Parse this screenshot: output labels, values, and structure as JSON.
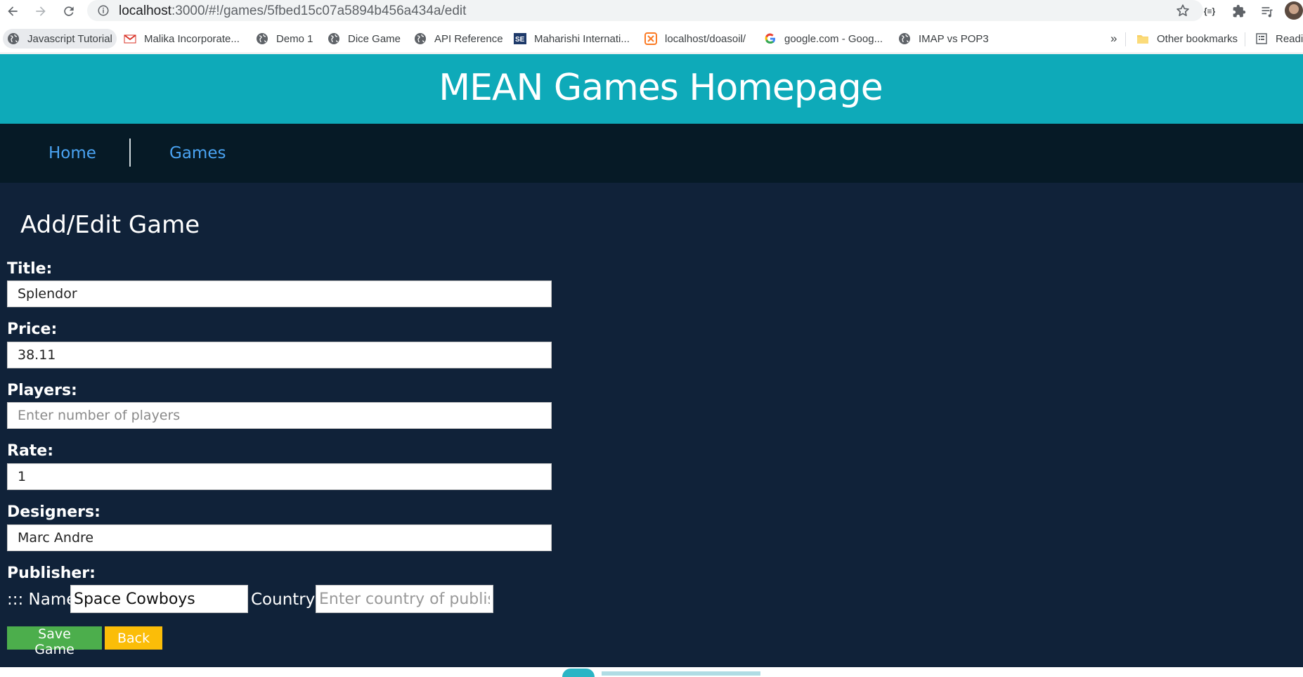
{
  "browser": {
    "url_host": "localhost",
    "url_path": ":3000/#!/games/5fbed15c07a5894b456a434a/edit",
    "bookmarks": [
      {
        "label": "Javascript Tutorial",
        "icon": "globe-icon"
      },
      {
        "label": "Malika Incorporate...",
        "icon": "gmail-icon"
      },
      {
        "label": "Demo 1",
        "icon": "globe-icon"
      },
      {
        "label": "Dice Game",
        "icon": "globe-icon"
      },
      {
        "label": "API Reference",
        "icon": "globe-icon"
      },
      {
        "label": "Maharishi Internati...",
        "icon": "se-icon"
      },
      {
        "label": "localhost/doasoil/",
        "icon": "xampp-icon"
      },
      {
        "label": "google.com - Goog...",
        "icon": "google-icon"
      },
      {
        "label": "IMAP vs POP3",
        "icon": "globe-icon"
      }
    ],
    "overflow_label": "»",
    "other_bookmarks": "Other bookmarks",
    "reading_list": "Readi"
  },
  "site": {
    "title": "MEAN Games Homepage",
    "nav": [
      {
        "label": "Home"
      },
      {
        "label": "Games"
      }
    ]
  },
  "form": {
    "heading": "Add/Edit Game",
    "fields": [
      {
        "label": "Title:",
        "value": "Splendor",
        "placeholder": ""
      },
      {
        "label": "Price:",
        "value": "38.11",
        "placeholder": ""
      },
      {
        "label": "Players:",
        "value": "",
        "placeholder": "Enter number of players"
      },
      {
        "label": "Rate:",
        "value": "1",
        "placeholder": ""
      },
      {
        "label": "Designers:",
        "value": "Marc Andre",
        "placeholder": ""
      }
    ],
    "publisher": {
      "label": "Publisher:",
      "name_label": "::: Name:",
      "name_value": "Space Cowboys",
      "country_label": "Country:",
      "country_value": "",
      "country_placeholder": "Enter country of publisher"
    },
    "buttons": {
      "save": "Save Game",
      "back": "Back"
    }
  },
  "colors": {
    "header_bg": "#0eaab9",
    "nav_bg": "#061a26",
    "page_bg": "#102239",
    "link": "#4aa3f2",
    "save_button": "#4cae4c",
    "back_button": "#fbbd08"
  }
}
